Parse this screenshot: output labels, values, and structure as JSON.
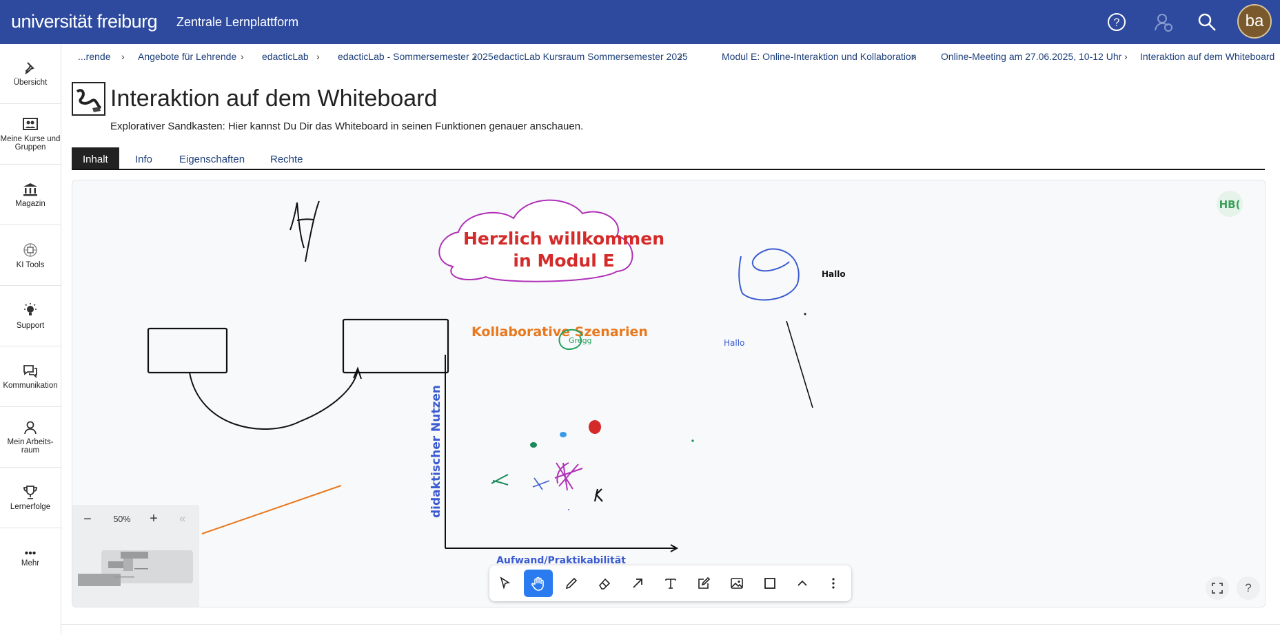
{
  "header": {
    "logo": "universität freiburg",
    "platform": "Zentrale Lernplattform",
    "avatar": "ba",
    "icons": [
      "help-icon",
      "user-status-icon",
      "search-icon"
    ]
  },
  "sidebar": {
    "items": [
      {
        "label": "Übersicht",
        "icon": "pin-icon"
      },
      {
        "label": "Meine Kurse und Gruppen",
        "icon": "group-icon"
      },
      {
        "label": "Magazin",
        "icon": "museum-icon"
      },
      {
        "label": "KI Tools",
        "icon": "chip-icon"
      },
      {
        "label": "Support",
        "icon": "bulb-icon"
      },
      {
        "label": "Kommunikation",
        "icon": "chat-icon"
      },
      {
        "label": "Mein Arbeits-raum",
        "icon": "person-icon"
      },
      {
        "label": "Lernerfolge",
        "icon": "trophy-icon"
      },
      {
        "label": "Mehr",
        "icon": "more-icon"
      }
    ]
  },
  "breadcrumb": [
    "...rende",
    "Angebote für Lehrende",
    "edacticLab",
    "edacticLab - Sommersemester 2025",
    "edacticLab Kursraum Sommersemester 2025",
    "Modul E: Online-Interaktion und Kollaboration",
    "Online-Meeting am 27.06.2025, 10-12 Uhr",
    "Interaktion auf dem Whiteboard"
  ],
  "page": {
    "title": "Interaktion auf dem Whiteboard",
    "description": "Explorativer Sandkasten: Hier kannst Du Dir das Whiteboard in seinen Funktionen genauer anschauen."
  },
  "tabs": [
    {
      "label": "Inhalt",
      "active": true
    },
    {
      "label": "Info",
      "active": false
    },
    {
      "label": "Eigenschaften",
      "active": false
    },
    {
      "label": "Rechte",
      "active": false
    }
  ],
  "whiteboard": {
    "cloud_text_1": "Herzlich willkommen",
    "cloud_text_2": "in Modul E",
    "heading": "Kollaborative Szenarien",
    "hallo_black": "Hallo",
    "hallo_blue": "Hallo",
    "small_label": "Gregg",
    "y_axis_label": "didaktischer Nutzen",
    "x_axis_label": "Aufwand/Praktikabilität",
    "user_badge": "HB(",
    "zoom": "50%",
    "colors": {
      "red": "#d42a2a",
      "orange": "#e8781e",
      "blue": "#3a5bd1",
      "purple": "#b030b8",
      "green": "#20a05a",
      "accent": "#2b7bf0"
    }
  },
  "toolbar": {
    "tools": [
      "select-tool",
      "hand-tool",
      "pen-tool",
      "eraser-tool",
      "arrow-tool",
      "text-tool",
      "note-tool",
      "image-tool",
      "shape-tool",
      "more-shapes-tool",
      "overflow-tool"
    ],
    "active": "hand-tool"
  }
}
